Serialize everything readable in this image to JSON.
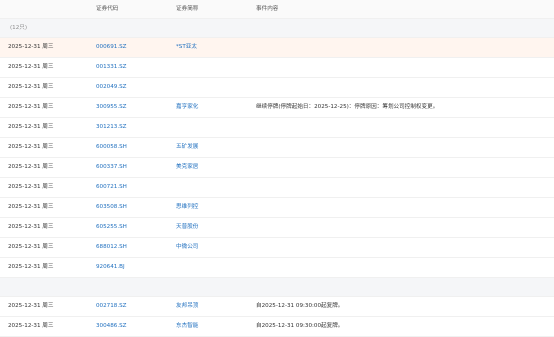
{
  "colors": {
    "link": "#1f6fbf",
    "accent_red": "#e8453c",
    "highlight_row_bg": "#fff5ef",
    "group_bg": "#f5f6f8"
  },
  "header": {
    "col_date": "",
    "col_code": "证券代码",
    "col_name": "证券简称",
    "col_event": "事件内容"
  },
  "groups": [
    {
      "title": "",
      "count": "(12只)",
      "rows": [
        {
          "date": "2025-12-31 周三",
          "code": "000691.SZ",
          "name": "*ST亚太",
          "event": "",
          "highlight": true
        },
        {
          "date": "2025-12-31 周三",
          "code": "001331.SZ",
          "name": "",
          "event": "",
          "highlight": false
        },
        {
          "date": "2025-12-31 周三",
          "code": "002049.SZ",
          "name": "",
          "event": "",
          "highlight": false
        },
        {
          "date": "2025-12-31 周三",
          "code": "300955.SZ",
          "name": "嘉亨家化",
          "event": "继续停牌(停牌起始日：2025-12-25)：停牌原因：筹划公司控制权变更。",
          "highlight": false
        },
        {
          "date": "2025-12-31 周三",
          "code": "301213.SZ",
          "name": "",
          "event": "",
          "highlight": false
        },
        {
          "date": "2025-12-31 周三",
          "code": "600058.SH",
          "name": "五矿发展",
          "event": "",
          "highlight": false
        },
        {
          "date": "2025-12-31 周三",
          "code": "600337.SH",
          "name": "美克家居",
          "event": "",
          "highlight": false
        },
        {
          "date": "2025-12-31 周三",
          "code": "600721.SH",
          "name": "",
          "event": "",
          "highlight": false
        },
        {
          "date": "2025-12-31 周三",
          "code": "603508.SH",
          "name": "思维列控",
          "event": "",
          "highlight": false
        },
        {
          "date": "2025-12-31 周三",
          "code": "605255.SH",
          "name": "天普股份",
          "event": "",
          "highlight": false
        },
        {
          "date": "2025-12-31 周三",
          "code": "688012.SH",
          "name": "中微公司",
          "event": "",
          "highlight": false
        },
        {
          "date": "2025-12-31 周三",
          "code": "920641.BJ",
          "name": "",
          "event": "",
          "highlight": false
        }
      ]
    },
    {
      "title": "",
      "count": "",
      "rows": [
        {
          "date": "2025-12-31 周三",
          "code": "002718.SZ",
          "name": "友邦吊顶",
          "event": "自2025-12-31 09:30:00起复牌。",
          "highlight": false
        },
        {
          "date": "2025-12-31 周三",
          "code": "300486.SZ",
          "name": "东杰智能",
          "event": "自2025-12-31 09:30:00起复牌。",
          "highlight": false
        }
      ]
    }
  ]
}
